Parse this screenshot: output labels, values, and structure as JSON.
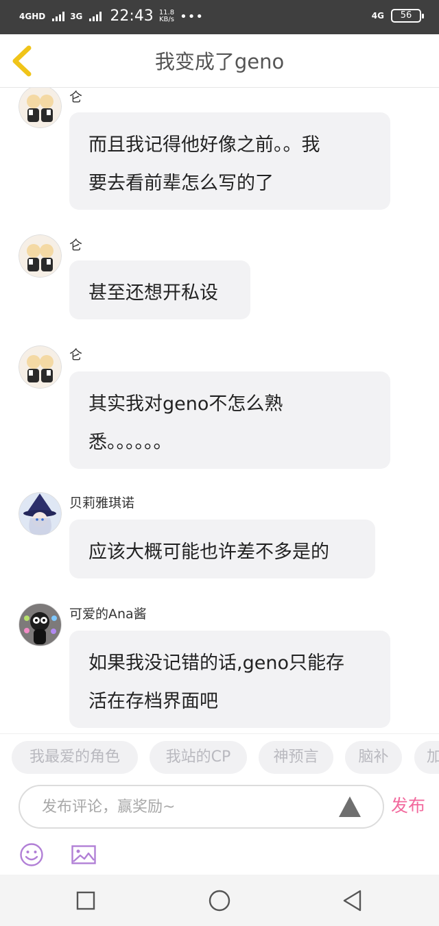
{
  "status_bar": {
    "network_1": "4GHD",
    "network_2": "3G",
    "time": "22:43",
    "speed_value": "11.8",
    "speed_unit": "KB/s",
    "more": "•••",
    "network_right": "4G",
    "battery": "56"
  },
  "header": {
    "title": "我变成了geno"
  },
  "messages": [
    {
      "user": "仑",
      "lines": [
        "而且我记得他好像之前。。我",
        "要去看前辈怎么写的了"
      ]
    },
    {
      "user": "仑",
      "lines": [
        "甚至还想开私设"
      ]
    },
    {
      "user": "仑",
      "lines": [
        "其实我对geno不怎么熟",
        "悉。。。。。。"
      ]
    },
    {
      "user": "贝莉雅琪诺",
      "lines": [
        "应该大概可能也许差不多是的"
      ]
    },
    {
      "user": "可爱的Ana酱",
      "lines": [
        "如果我没记错的话,geno只能存",
        "活在存档界面吧"
      ]
    }
  ],
  "chips": [
    "我最爱的角色",
    "我站的CP",
    "神预言",
    "脑补",
    "加"
  ],
  "input": {
    "placeholder": "发布评论，赢奖励~",
    "publish_label": "发布"
  },
  "colors": {
    "accent": "#f2699d",
    "back_arrow": "#f0c419",
    "bubble": "#f2f2f4",
    "status_bar": "#3f3f3f",
    "toolbar_icon": "#b17fd6"
  },
  "icons": {
    "back": "chevron-left-icon",
    "send": "triangle-up-icon",
    "emoji": "smiley-icon",
    "image": "image-icon"
  }
}
